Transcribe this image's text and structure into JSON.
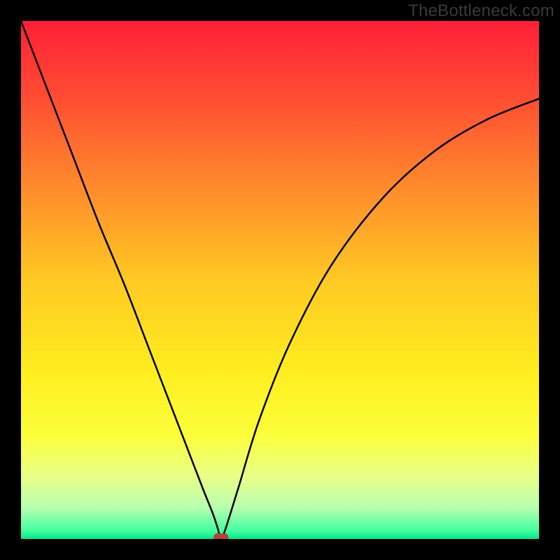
{
  "watermark": "TheBottleneck.com",
  "chart_data": {
    "type": "line",
    "title": "",
    "xlabel": "",
    "ylabel": "",
    "xlim": [
      0,
      100
    ],
    "ylim": [
      0,
      100
    ],
    "legend": false,
    "grid": false,
    "background_gradient": {
      "stops": [
        {
          "offset": 0.0,
          "color": "#ff1f37"
        },
        {
          "offset": 0.14,
          "color": "#ff4a33"
        },
        {
          "offset": 0.32,
          "color": "#ff8a2c"
        },
        {
          "offset": 0.5,
          "color": "#ffc923"
        },
        {
          "offset": 0.68,
          "color": "#ffee20"
        },
        {
          "offset": 0.8,
          "color": "#fbff3a"
        },
        {
          "offset": 0.88,
          "color": "#e9ff88"
        },
        {
          "offset": 0.94,
          "color": "#b7ffb0"
        },
        {
          "offset": 0.985,
          "color": "#3fff9f"
        },
        {
          "offset": 1.0,
          "color": "#00e589"
        }
      ]
    },
    "series": [
      {
        "name": "bottleneck-curve",
        "x": [
          0,
          5,
          10,
          15,
          20,
          25,
          30,
          35,
          37,
          38,
          38.6,
          39.5,
          42,
          46,
          52,
          60,
          70,
          80,
          90,
          100
        ],
        "y": [
          100,
          87,
          74,
          61,
          49,
          36,
          23,
          10,
          5,
          2,
          0,
          2,
          10,
          23,
          38,
          53,
          66,
          75,
          81,
          85
        ]
      }
    ],
    "marker": {
      "name": "optimal-point",
      "x": 38.6,
      "y": 0,
      "shape": "rounded-rect",
      "color": "#b4423e"
    }
  }
}
